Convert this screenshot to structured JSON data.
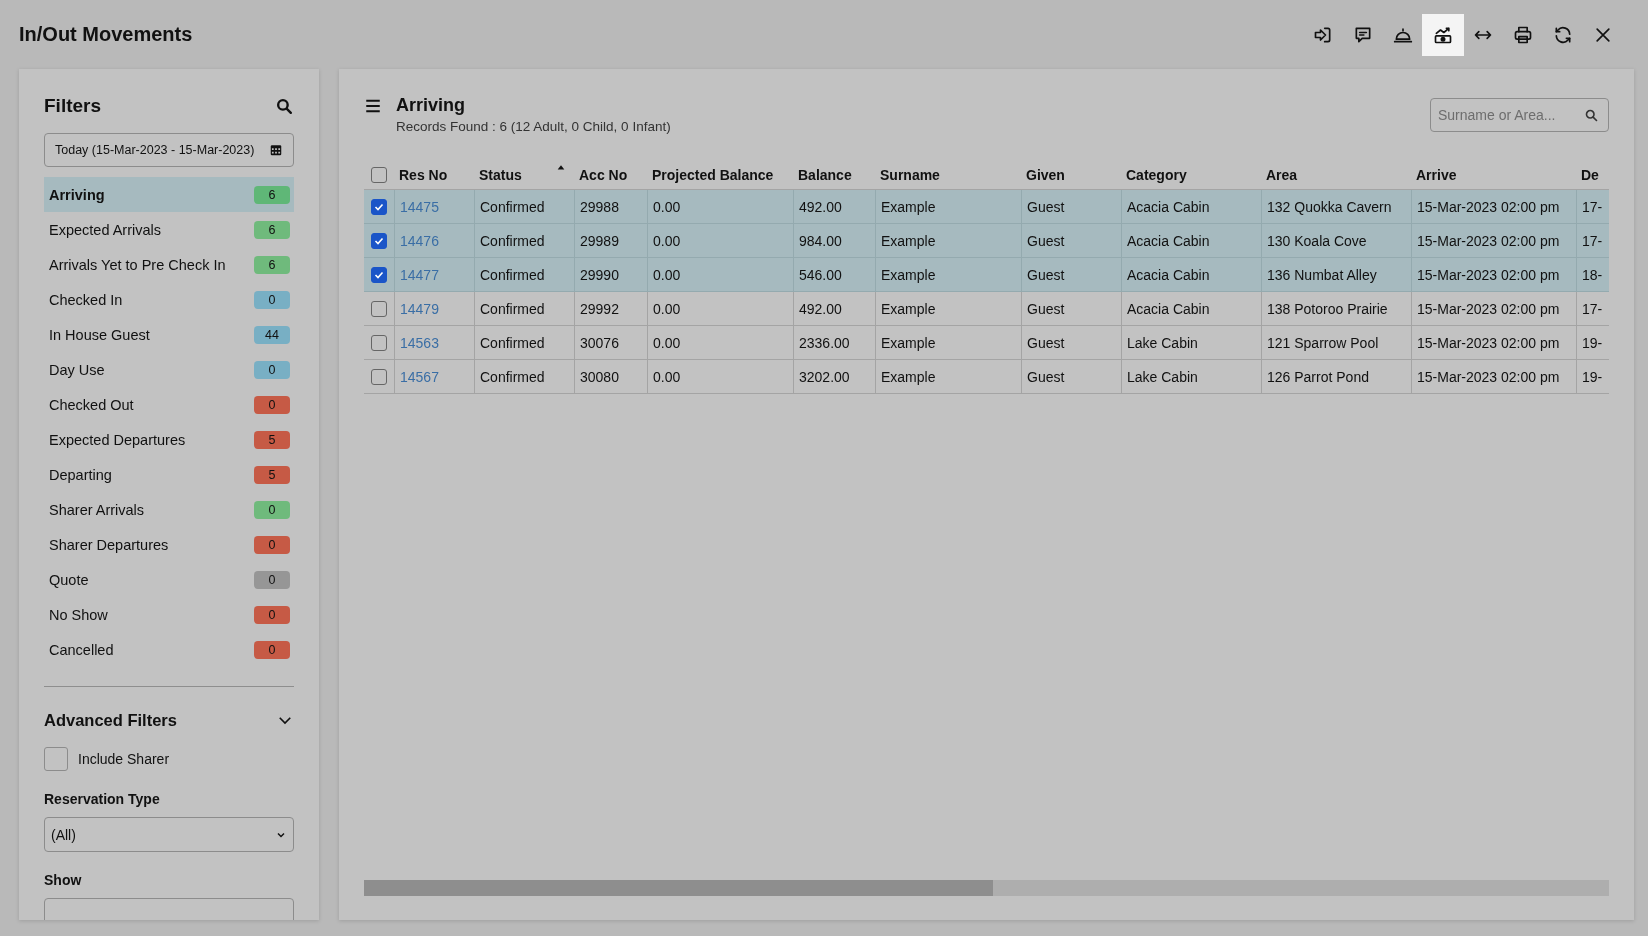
{
  "window": {
    "title": "In/Out Movements"
  },
  "toolbar": [
    {
      "selected": false
    },
    {
      "selected": false
    },
    {
      "selected": false
    },
    {
      "selected": true
    },
    {
      "selected": false
    },
    {
      "selected": false
    },
    {
      "selected": false
    },
    {
      "selected": false
    }
  ],
  "sidebar": {
    "title": "Filters",
    "date_range": "Today (15-Mar-2023 - 15-Mar-2023)",
    "items": [
      {
        "label": "Arriving",
        "count": "6",
        "color": "#5fb777",
        "selected": true
      },
      {
        "label": "Expected Arrivals",
        "count": "6",
        "color": "#6fba7c",
        "selected": false
      },
      {
        "label": "Arrivals Yet to Pre Check In",
        "count": "6",
        "color": "#6fba7c",
        "selected": false
      },
      {
        "label": "Checked In",
        "count": "0",
        "color": "#78afc4",
        "selected": false
      },
      {
        "label": "In House Guest",
        "count": "44",
        "color": "#78afc4",
        "selected": false
      },
      {
        "label": "Day Use",
        "count": "0",
        "color": "#78afc4",
        "selected": false
      },
      {
        "label": "Checked Out",
        "count": "0",
        "color": "#c65a45",
        "selected": false
      },
      {
        "label": "Expected Departures",
        "count": "5",
        "color": "#c65a45",
        "selected": false
      },
      {
        "label": "Departing",
        "count": "5",
        "color": "#c65a45",
        "selected": false
      },
      {
        "label": "Sharer Arrivals",
        "count": "0",
        "color": "#6fba7c",
        "selected": false
      },
      {
        "label": "Sharer Departures",
        "count": "0",
        "color": "#c65a45",
        "selected": false
      },
      {
        "label": "Quote",
        "count": "0",
        "color": "#969696",
        "selected": false
      },
      {
        "label": "No Show",
        "count": "0",
        "color": "#c65a45",
        "selected": false
      },
      {
        "label": "Cancelled",
        "count": "0",
        "color": "#c65a45",
        "selected": false
      }
    ],
    "advanced_filters": {
      "title": "Advanced Filters",
      "expanded": true,
      "include_sharer": {
        "label": "Include Sharer",
        "checked": false
      },
      "reservation_type": {
        "label": "Reservation Type",
        "value": "(All)"
      },
      "show": {
        "label": "Show"
      }
    }
  },
  "main": {
    "title": "Arriving",
    "summary": "Records Found : 6 (12 Adult, 0 Child, 0 Infant)",
    "search": {
      "placeholder": "Surname or Area..."
    },
    "table": {
      "all_checked": false,
      "columns": [
        {
          "label": "Res No",
          "kind": "link"
        },
        {
          "label": "Status",
          "kind": "text",
          "sorted": true
        },
        {
          "label": "Acc No",
          "kind": "text"
        },
        {
          "label": "Projected Balance",
          "kind": "text"
        },
        {
          "label": "Balance",
          "kind": "text"
        },
        {
          "label": "Surname",
          "kind": "text"
        },
        {
          "label": "Given",
          "kind": "text"
        },
        {
          "label": "Category",
          "kind": "text"
        },
        {
          "label": "Area",
          "kind": "text"
        },
        {
          "label": "Arrive",
          "kind": "text"
        },
        {
          "label": "De",
          "kind": "text"
        }
      ],
      "rows": [
        {
          "checked": true,
          "cells": [
            "14475",
            "Confirmed",
            "29988",
            "0.00",
            "492.00",
            "Example",
            "Guest",
            "Acacia Cabin",
            "132 Quokka Cavern",
            "15-Mar-2023 02:00 pm",
            "17-"
          ]
        },
        {
          "checked": true,
          "cells": [
            "14476",
            "Confirmed",
            "29989",
            "0.00",
            "984.00",
            "Example",
            "Guest",
            "Acacia Cabin",
            "130 Koala Cove",
            "15-Mar-2023 02:00 pm",
            "17-"
          ]
        },
        {
          "checked": true,
          "cells": [
            "14477",
            "Confirmed",
            "29990",
            "0.00",
            "546.00",
            "Example",
            "Guest",
            "Acacia Cabin",
            "136 Numbat Alley",
            "15-Mar-2023 02:00 pm",
            "18-"
          ]
        },
        {
          "checked": false,
          "cells": [
            "14479",
            "Confirmed",
            "29992",
            "0.00",
            "492.00",
            "Example",
            "Guest",
            "Acacia Cabin",
            "138 Potoroo Prairie",
            "15-Mar-2023 02:00 pm",
            "17-"
          ]
        },
        {
          "checked": false,
          "cells": [
            "14563",
            "Confirmed",
            "30076",
            "0.00",
            "2336.00",
            "Example",
            "Guest",
            "Lake Cabin",
            "121 Sparrow Pool",
            "15-Mar-2023 02:00 pm",
            "19-"
          ]
        },
        {
          "checked": false,
          "cells": [
            "14567",
            "Confirmed",
            "30080",
            "0.00",
            "3202.00",
            "Example",
            "Guest",
            "Lake Cabin",
            "126 Parrot Pond",
            "15-Mar-2023 02:00 pm",
            "19-"
          ]
        }
      ]
    }
  }
}
